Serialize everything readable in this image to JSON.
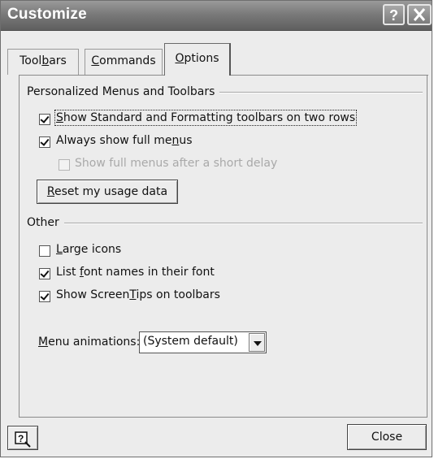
{
  "window": {
    "title": "Customize"
  },
  "titlebar": {
    "help_icon": "help-question-icon",
    "close_icon": "close-x-icon"
  },
  "tabs": [
    {
      "label_pre": "Tool",
      "label_key": "b",
      "label_post": "ars",
      "selected": false
    },
    {
      "label_pre": "",
      "label_key": "C",
      "label_post": "ommands",
      "selected": false
    },
    {
      "label_pre": "",
      "label_key": "O",
      "label_post": "ptions",
      "selected": true
    }
  ],
  "personalized": {
    "heading": "Personalized Menus and Toolbars",
    "options": [
      {
        "pre": "",
        "key": "S",
        "post": "how Standard and Formatting toolbars on two rows",
        "checked": true,
        "enabled": true
      },
      {
        "pre": "Always show full me",
        "key": "n",
        "post": "us",
        "checked": true,
        "enabled": true
      },
      {
        "pre": "Show full menus after a short delay",
        "key": "",
        "post": "",
        "checked": false,
        "enabled": false
      }
    ],
    "reset_button": {
      "pre": "",
      "key": "R",
      "post": "eset my usage data"
    }
  },
  "other": {
    "heading": "Other",
    "options": [
      {
        "pre": "",
        "key": "L",
        "post": "arge icons",
        "checked": false,
        "enabled": true
      },
      {
        "pre": "List ",
        "key": "f",
        "post": "ont names in their font",
        "checked": true,
        "enabled": true
      },
      {
        "pre": "Show Screen",
        "key": "T",
        "post": "ips on toolbars",
        "checked": true,
        "enabled": true
      }
    ],
    "menu_animations": {
      "label_pre": "",
      "label_key": "M",
      "label_post": "enu animations:",
      "value": "(System default)"
    }
  },
  "footer": {
    "help_icon": "context-help-icon",
    "close_label": "Close"
  }
}
